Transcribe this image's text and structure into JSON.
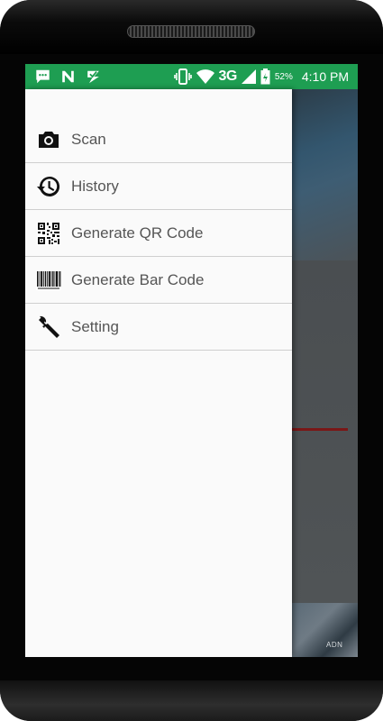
{
  "status_bar": {
    "network": "3G",
    "battery_percent": "52%",
    "time": "4:10 PM",
    "color": "#1e9e52",
    "left_icons": [
      "message-icon",
      "n-icon",
      "check-chat-icon"
    ],
    "right_icons": [
      "vibrate-icon",
      "wifi-icon",
      "signal-icon",
      "battery-icon"
    ]
  },
  "drawer": {
    "items": [
      {
        "label": "Scan",
        "icon": "camera-icon"
      },
      {
        "label": "History",
        "icon": "history-icon"
      },
      {
        "label": "Generate QR Code",
        "icon": "qr-code-icon"
      },
      {
        "label": "Generate Bar Code",
        "icon": "barcode-icon"
      },
      {
        "label": "Setting",
        "icon": "wrench-icon"
      }
    ]
  },
  "background": {
    "logo_text": "ADN"
  }
}
